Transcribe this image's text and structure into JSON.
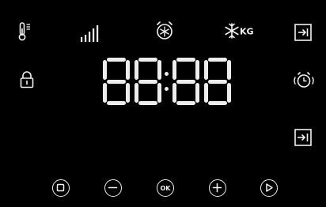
{
  "display": {
    "time_digits": [
      "8",
      "8",
      "8",
      "8"
    ],
    "separator": ":"
  },
  "indicators": {
    "temperature": "thermometer-icon",
    "power_level": "signal-bars-icon",
    "timer_defrost": "timer-snowflake-icon",
    "defrost_weight": "defrost-kg-icon",
    "defrost_weight_unit": "KG",
    "child_lock": "padlock-icon",
    "alarm": "alarm-clock-icon"
  },
  "side_buttons": {
    "end_time": "end-time-icon",
    "start_time": "start-time-icon"
  },
  "bottom_buttons": {
    "stop": "stop-icon",
    "minus": "minus-icon",
    "ok_label": "OK",
    "plus": "plus-icon",
    "play": "play-icon"
  },
  "colors": {
    "background": "#000000",
    "foreground": "#f2f2f2"
  }
}
